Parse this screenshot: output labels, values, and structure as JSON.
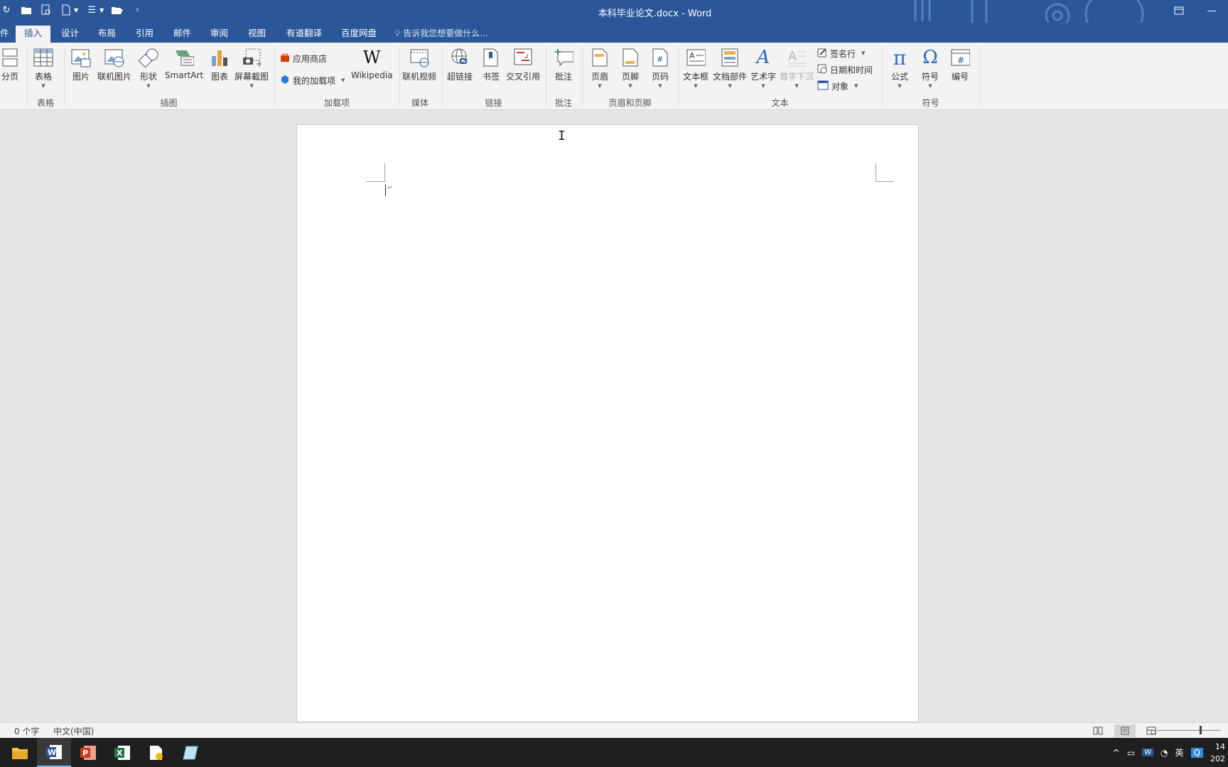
{
  "window": {
    "title": "本科毕业论文.docx - Word"
  },
  "tabs": [
    {
      "label": "插入",
      "active": true
    },
    {
      "label": "设计"
    },
    {
      "label": "布局"
    },
    {
      "label": "引用"
    },
    {
      "label": "邮件"
    },
    {
      "label": "审阅"
    },
    {
      "label": "视图"
    },
    {
      "label": "有道翻译"
    },
    {
      "label": "百度网盘"
    }
  ],
  "tab_file_partial": "件",
  "tell_me": "告诉我您想要做什么...",
  "ribbon": {
    "pages": {
      "page_break": "分页"
    },
    "table": {
      "table": "表格",
      "group": "表格"
    },
    "illustrations": {
      "picture": "图片",
      "online_picture": "联机图片",
      "shapes": "形状",
      "smartart": "SmartArt",
      "chart": "图表",
      "screenshot": "屏幕截图",
      "group": "插图"
    },
    "addins": {
      "store": "应用商店",
      "my_addins": "我的加载项",
      "wikipedia": "Wikipedia",
      "group": "加载项"
    },
    "media": {
      "online_video": "联机视频",
      "group": "媒体"
    },
    "links": {
      "hyperlink": "超链接",
      "bookmark": "书签",
      "cross_ref": "交叉引用",
      "group": "链接"
    },
    "comments": {
      "comment": "批注",
      "group": "批注"
    },
    "header_footer": {
      "header": "页眉",
      "footer": "页脚",
      "page_number": "页码",
      "group": "页眉和页脚"
    },
    "text": {
      "textbox": "文本框",
      "quick_parts": "文档部件",
      "wordart": "艺术字",
      "dropcap": "首字下沉",
      "signature": "签名行",
      "datetime": "日期和时间",
      "object": "对象",
      "group": "文本"
    },
    "symbols": {
      "equation": "公式",
      "symbol": "符号",
      "number": "编号",
      "group": "符号"
    }
  },
  "status": {
    "word_count": "0 个字",
    "language": "中文(中国)"
  },
  "taskbar": {
    "tray_ime": "英",
    "clock_time": "14",
    "clock_date": "202"
  },
  "colors": {
    "word_blue": "#2b579a",
    "ribbon_bg": "#f3f3f3",
    "canvas_bg": "#e6e6e6",
    "taskbar_bg": "#1f1f1f"
  }
}
